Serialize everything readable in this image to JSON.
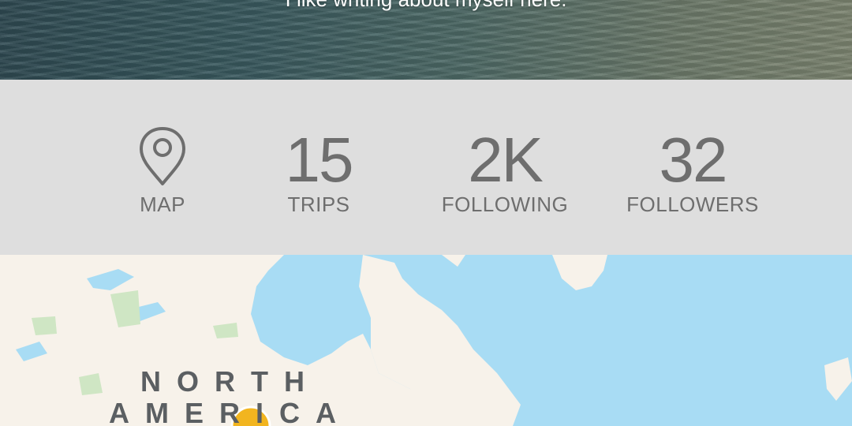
{
  "profile": {
    "bio": "I like writing about myself here."
  },
  "stats": {
    "map_label": "MAP",
    "trips": {
      "value": "15",
      "label": "TRIPS"
    },
    "following": {
      "value": "2K",
      "label": "FOLLOWING"
    },
    "followers": {
      "value": "32",
      "label": "FOLLOWERS"
    }
  },
  "map": {
    "continent_line1": "NORTH",
    "continent_line2": "AMERICA",
    "water_color": "#a8dcf4",
    "land_color": "#f7f2ea",
    "park_color": "#cfe6c4",
    "marker_color": "#f2b51f"
  },
  "icons": {
    "map": "map-pin-icon",
    "marker": "location-marker-icon"
  },
  "colors": {
    "stats_background": "#dedede",
    "stats_text": "#6e6e6e"
  }
}
